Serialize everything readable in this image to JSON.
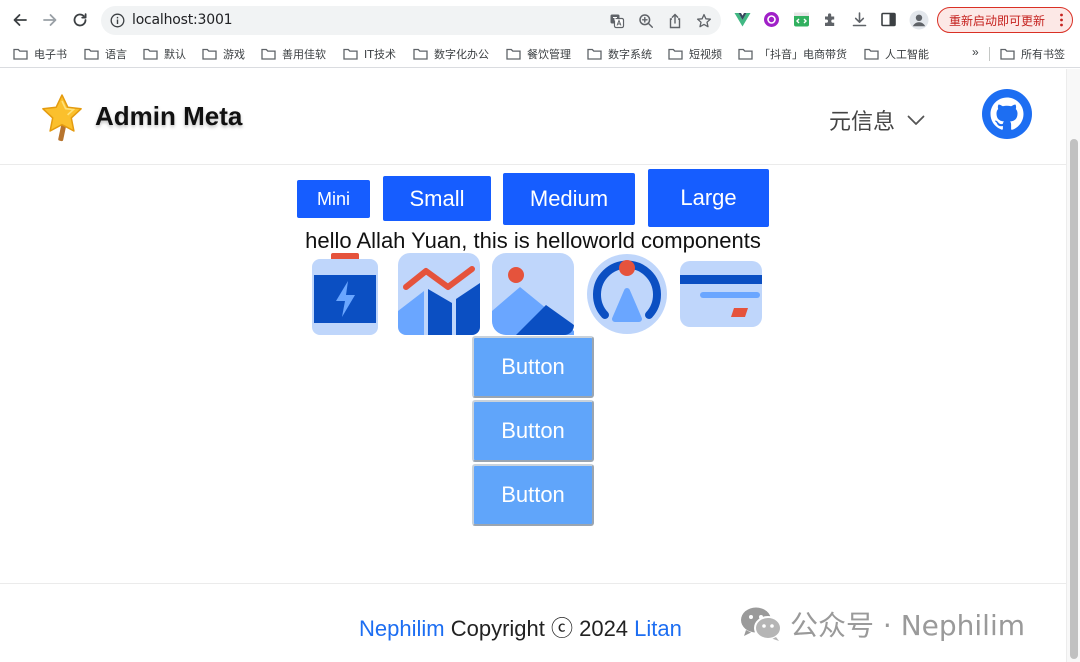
{
  "browser": {
    "url": "localhost:3001",
    "restart_label": "重新启动即可更新",
    "bookmarks": [
      "电子书",
      "语言",
      "默认",
      "游戏",
      "善用佳软",
      "IT技术",
      "数字化办公",
      "餐饮管理",
      "数字系统",
      "短视频",
      "「抖音」电商带货",
      "人工智能"
    ],
    "bookmarks_more": "»",
    "all_bookmarks": "所有书签"
  },
  "header": {
    "brand": "Admin Meta",
    "menu_label": "元信息"
  },
  "sizes": {
    "mini": "Mini",
    "small": "Small",
    "medium": "Medium",
    "large": "Large"
  },
  "hello_text": "hello Allah Yuan, this is helloworld components",
  "stack_buttons": [
    "Button",
    "Button",
    "Button"
  ],
  "footer": {
    "left_link": "Nephilim",
    "middle": "Copyright ⓒ 2024",
    "right_link": "Litan"
  },
  "watermark": "公众号 · Nephilim",
  "colors": {
    "primary": "#165dff",
    "button_light": "#60a5fa",
    "icon_dark": "#0b4fc2",
    "icon_light": "#bfd6fb",
    "accent": "#e5533c",
    "link": "#1d6ef2"
  }
}
